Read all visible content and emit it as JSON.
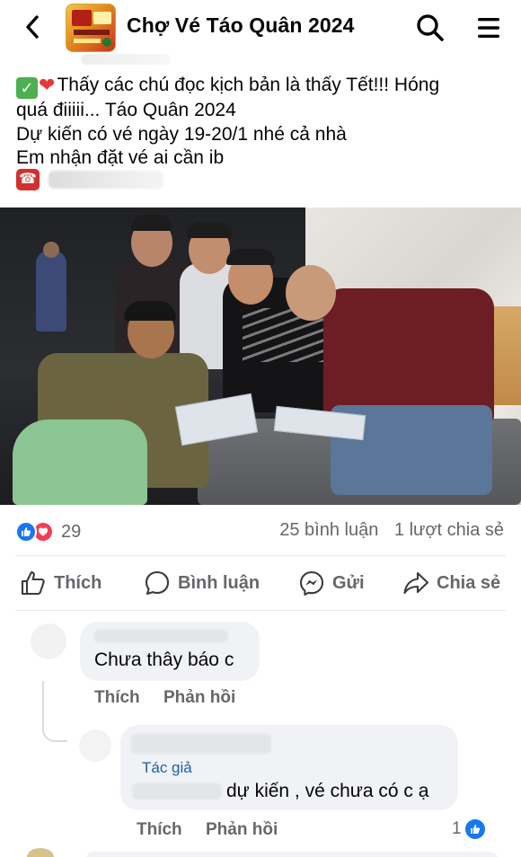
{
  "header": {
    "group_title": "Chợ Vé Táo Quân 2024",
    "icons": [
      "back-arrow-icon",
      "group-avatar",
      "search-icon",
      "menu-icon"
    ]
  },
  "post": {
    "lines": [
      "Thấy các chú đọc kịch bản là thấy Tết!!! Hóng",
      "quá điiiii... Táo Quân 2024",
      "Dự kiến có vé ngày 19-20/1 nhé cả nhà",
      "Em nhận đặt vé ai cần ib"
    ],
    "lead_emojis": [
      "check-mark-icon",
      "heart-icon"
    ],
    "phone_icon": "telephone-icon"
  },
  "reactions": {
    "count": "29",
    "comments": "25 bình luận",
    "shares": "1 lượt chia sẻ",
    "colors": {
      "like": "#1877f2",
      "love": "#f33e58"
    }
  },
  "actions": {
    "like": "Thích",
    "comment": "Bình luận",
    "send": "Gửi",
    "share": "Chia sẻ"
  },
  "comments": [
    {
      "text": "Chưa thây báo c",
      "like_label": "Thích",
      "reply_label": "Phản hồi"
    },
    {
      "badge": "Tác giả",
      "text": "dự kiến , vé chưa có c ạ",
      "like_label": "Thích",
      "reply_label": "Phản hồi",
      "like_count": "1"
    }
  ]
}
